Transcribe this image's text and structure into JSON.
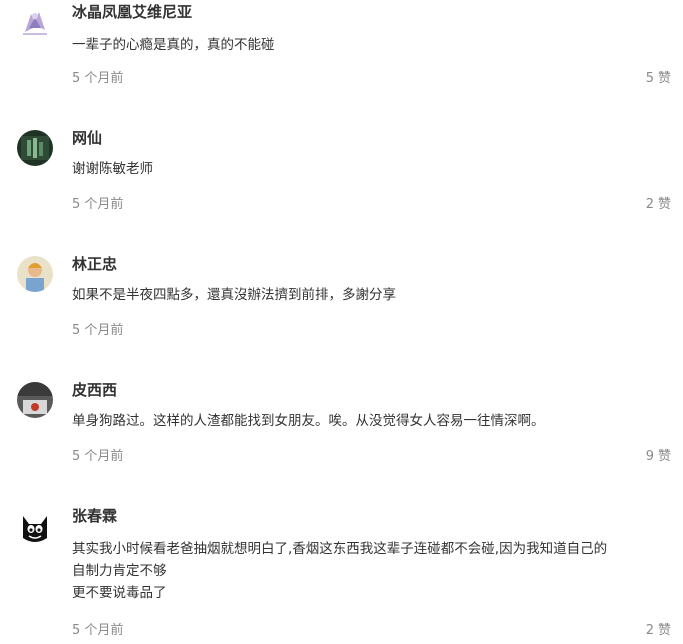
{
  "comments": [
    {
      "username": "冰晶凤凰艾维尼亚",
      "lines": [
        "一辈子的心瘾是真的，真的不能碰"
      ],
      "time": "5 个月前",
      "like_count": "5",
      "like_label": "赞"
    },
    {
      "username": "网仙",
      "lines": [
        "谢谢陈敏老师"
      ],
      "time": "5 个月前",
      "like_count": "2",
      "like_label": "赞"
    },
    {
      "username": "林正忠",
      "lines": [
        "如果不是半夜四點多，還真沒辦法擠到前排，多謝分享"
      ],
      "time": "5 个月前",
      "like_count": "",
      "like_label": ""
    },
    {
      "username": "皮西西",
      "lines": [
        "单身狗路过。这样的人渣都能找到女朋友。唉。从没觉得女人容易一往情深啊。"
      ],
      "time": "5 个月前",
      "like_count": "9",
      "like_label": "赞"
    },
    {
      "username": "张春霖",
      "lines": [
        "其实我小时候看老爸抽烟就想明白了,香烟这东西我这辈子连碰都不会碰,因为我知道自己的",
        "自制力肯定不够",
        "更不要说毒品了"
      ],
      "time": "5 个月前",
      "like_count": "2",
      "like_label": "赞"
    }
  ]
}
